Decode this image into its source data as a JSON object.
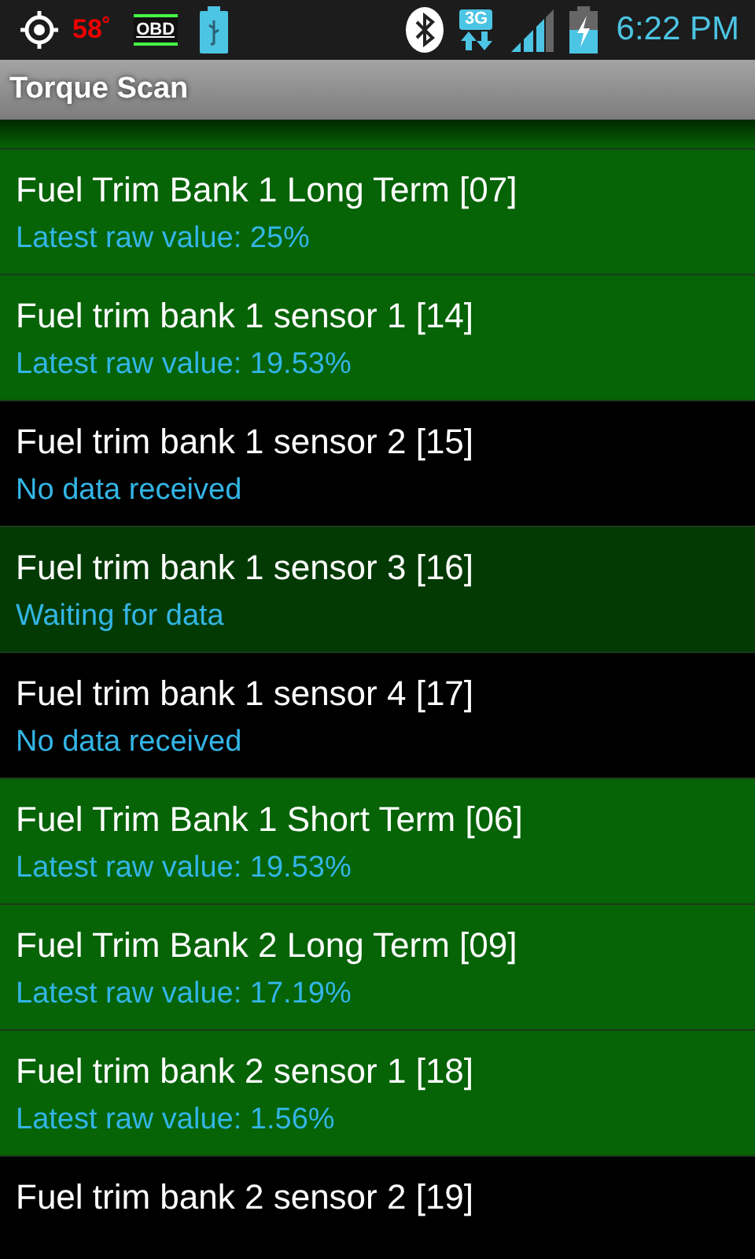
{
  "status_bar": {
    "temperature": "58˚",
    "obd_label": "OBD",
    "network": "3G",
    "time": "6:22 PM"
  },
  "action_bar": {
    "title": "Torque Scan"
  },
  "sensors": [
    {
      "name": "Fuel Trim Bank 1 Long Term [07]",
      "kind": "data",
      "status": "Latest raw value: 25%"
    },
    {
      "name": "Fuel trim bank 1 sensor 1 [14]",
      "kind": "data",
      "status": "Latest raw value: 19.53%"
    },
    {
      "name": "Fuel trim bank 1 sensor 2 [15]",
      "kind": "none",
      "status": "No data received"
    },
    {
      "name": "Fuel trim bank 1 sensor 3 [16]",
      "kind": "waiting",
      "status": "Waiting for data"
    },
    {
      "name": "Fuel trim bank 1 sensor 4 [17]",
      "kind": "none",
      "status": "No data received"
    },
    {
      "name": "Fuel Trim Bank 1 Short Term [06]",
      "kind": "data",
      "status": "Latest raw value: 19.53%"
    },
    {
      "name": "Fuel Trim Bank 2 Long Term [09]",
      "kind": "data",
      "status": "Latest raw value: 17.19%"
    },
    {
      "name": "Fuel trim bank 2 sensor 1 [18]",
      "kind": "data",
      "status": "Latest raw value: 1.56%"
    },
    {
      "name": "Fuel trim bank 2 sensor 2 [19]",
      "kind": "none"
    }
  ]
}
